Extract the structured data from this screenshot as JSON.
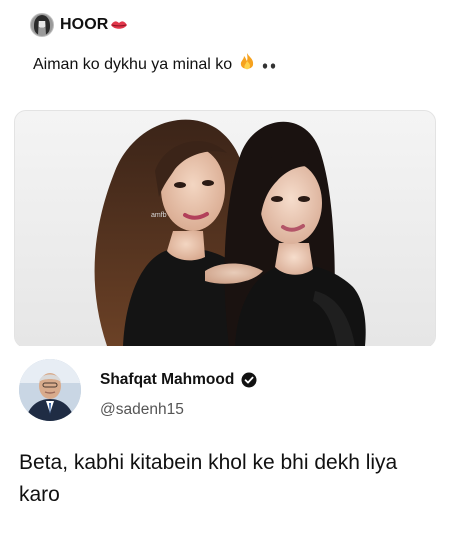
{
  "tweet": {
    "author_name": "HOOR",
    "author_avatar_icon": "profile-avatar-icon",
    "name_emoji_icon": "lips-icon",
    "text": "Aiman ko dykhu ya minal ko",
    "text_emoji_icon": "fire-icon",
    "text_suffix_icon": "eyes-icon",
    "photo_watermark": "amfb"
  },
  "reply": {
    "author_name": "Shafqat Mahmood",
    "verified_icon": "verified-badge-icon",
    "handle": "@sadenh15",
    "text": "Beta, kabhi kitabein khol ke bhi dekh liya karo"
  },
  "colors": {
    "background": "#ffffff",
    "text": "#111111",
    "handle": "#555555",
    "photo_background": "#eeeeee"
  }
}
